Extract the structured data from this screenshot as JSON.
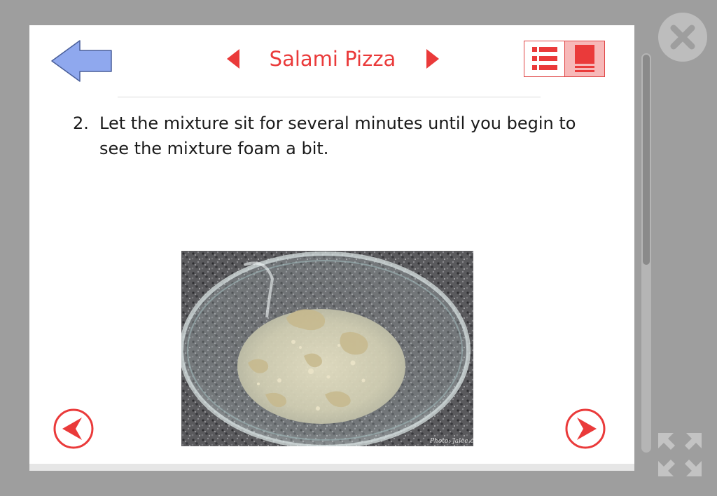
{
  "header": {
    "title": "Salami Pizza"
  },
  "step": {
    "number": "2.",
    "text": "Let the mixture sit for several minutes until you begin to see the mixture foam a bit."
  },
  "photo": {
    "watermark": "Photo: Jalee.com"
  },
  "icons": {
    "back": "back-arrow-icon",
    "prev_recipe": "triangle-left-icon",
    "next_recipe": "triangle-right-icon",
    "list_view": "list-view-icon",
    "page_view": "page-view-icon",
    "prev_step": "circle-chevron-left-icon",
    "next_step": "circle-chevron-right-icon",
    "close": "close-icon",
    "expand": "expand-icon"
  },
  "colors": {
    "accent": "#ea3a3a",
    "back_arrow": "#8fa8ee",
    "frame": "#9e9e9e",
    "toggle_active": "#f7b8b8"
  }
}
